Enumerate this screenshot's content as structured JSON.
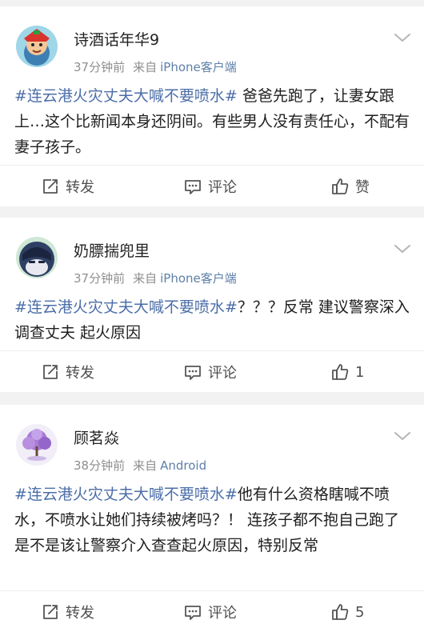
{
  "posts": [
    {
      "username": "诗酒话年华9",
      "time": "37分钟前",
      "source_label": "来自",
      "source": "iPhone客户端",
      "hashtag": "#连云港火灾丈夫大喊不要喷水#",
      "text": " 爸爸先跑了，让妻女跟上…这个比新闻本身还阴间。有些男人没有责任心，不配有妻子孩子。",
      "repost_label": "转发",
      "comment_label": "评论",
      "like_label": "赞"
    },
    {
      "username": "奶膘揣兜里",
      "time": "37分钟前",
      "source_label": "来自",
      "source": "iPhone客户端",
      "hashtag": "#连云港火灾丈夫大喊不要喷水#",
      "text": "？？？反常 建议警察深入调查丈夫 起火原因",
      "repost_label": "转发",
      "comment_label": "评论",
      "like_label": "1"
    },
    {
      "username": "顾茗焱",
      "time": "38分钟前",
      "source_label": "来自",
      "source": "Android",
      "hashtag": "#连云港火灾丈夫大喊不要喷水#",
      "text": "他有什么资格瞎喊不喷水，不喷水让她们持续被烤吗？！ 连孩子都不抱自己跑了是不是该让警察介入查查起火原因，特别反常",
      "repost_label": "转发",
      "comment_label": "评论",
      "like_label": "5"
    }
  ],
  "colors": {
    "hashtag": "#4b6ea8",
    "source": "#5d7fa8",
    "meta": "#8f8f8f",
    "background": "#f2f2f2"
  },
  "icons": [
    "repost-icon",
    "comment-icon",
    "like-icon",
    "chevron-down-icon"
  ]
}
